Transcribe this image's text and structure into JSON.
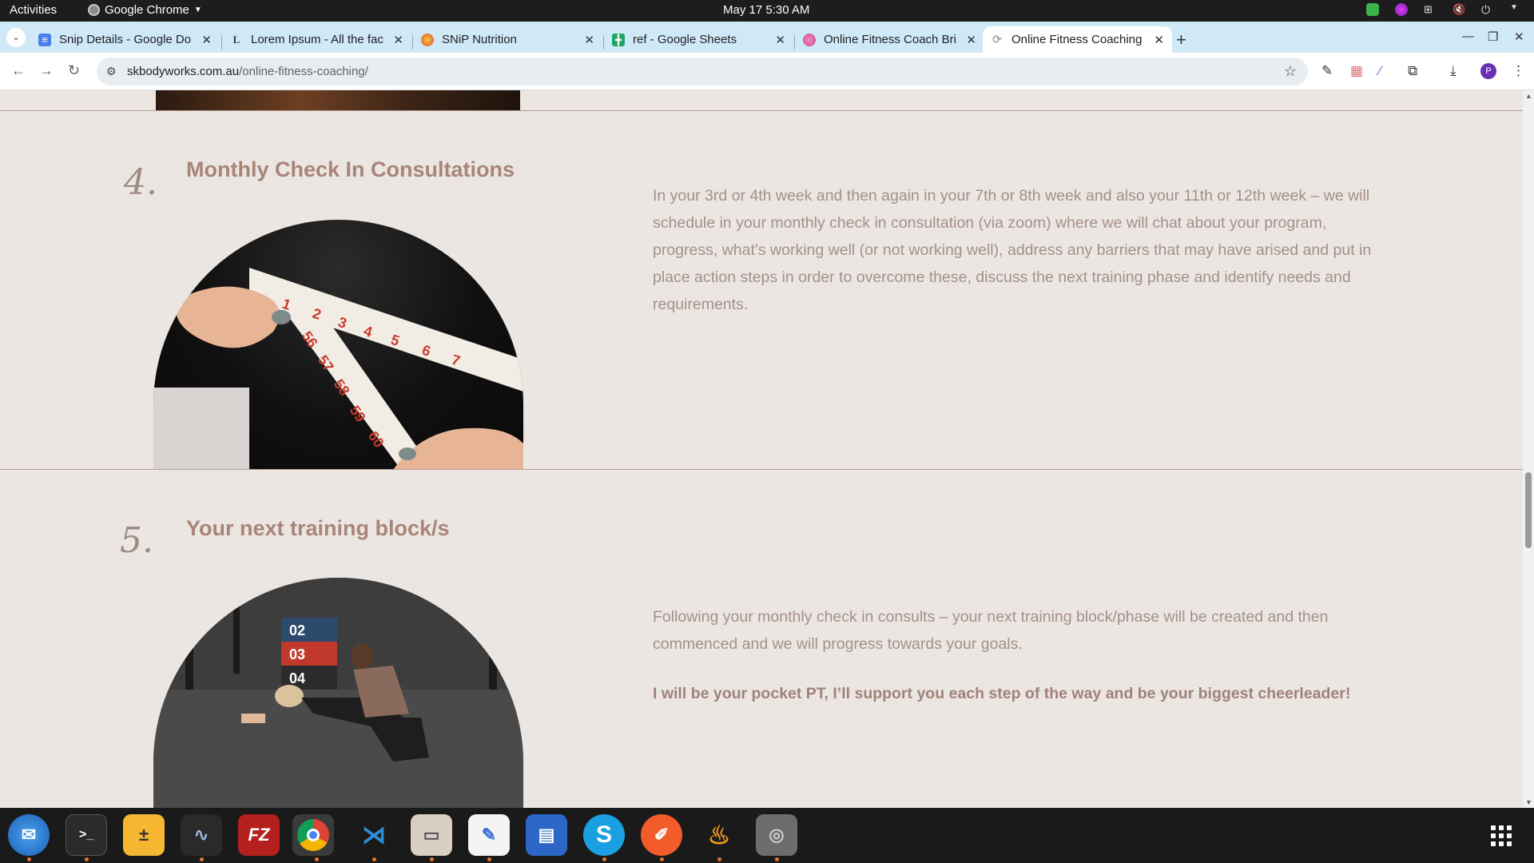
{
  "topbar": {
    "activities": "Activities",
    "app_name": "Google Chrome",
    "clock": "May 17  5:30 AM"
  },
  "tabs": [
    {
      "title": "Snip Details - Google Do",
      "favicon": "docs-icon",
      "color": "#4a7ee8"
    },
    {
      "title": "Lorem Ipsum - All the fac",
      "favicon": "lorem-icon",
      "color": "#333333"
    },
    {
      "title": "SNiP Nutrition",
      "favicon": "snip-icon",
      "color": "#e2532f"
    },
    {
      "title": "ref - Google Sheets",
      "favicon": "sheets-icon",
      "color": "#1fa463"
    },
    {
      "title": "Online Fitness Coach Bri",
      "favicon": "fitness-icon",
      "color": "#c5459b"
    },
    {
      "title": "Online Fitness Coaching",
      "favicon": "loading-icon",
      "color": "#999999",
      "active": true
    }
  ],
  "toolbar": {
    "url_host": "skbodyworks.com.au",
    "url_path": "/online-fitness-coaching/"
  },
  "steps": [
    {
      "number": "4.",
      "title": "Monthly Check In Consultations",
      "paragraphs": [
        "In your 3rd or 4th week and then again in your 7th or 8th week and also your 11th or 12th week – we will schedule in your monthly check in consultation (via zoom) where we will chat about your program, progress, what’s working well (or not working well), address any barriers that may have arised and put in place action steps in order to overcome these, discuss the next training phase and identify needs and requirements."
      ]
    },
    {
      "number": "5.",
      "title": "Your next training block/s",
      "paragraphs": [
        "Following your monthly check in consults – your next training block/phase will be created and then commenced and we will progress towards your goals."
      ],
      "highlight": "I will be your pocket PT, I’ll support you each step of the way and be your biggest cheerleader!"
    }
  ],
  "tape_numbers": [
    "1",
    "2",
    "3",
    "4",
    "5",
    "6",
    "7",
    "56",
    "57",
    "58",
    "59",
    "60"
  ],
  "gym_box_numbers": [
    "02",
    "03",
    "04"
  ]
}
